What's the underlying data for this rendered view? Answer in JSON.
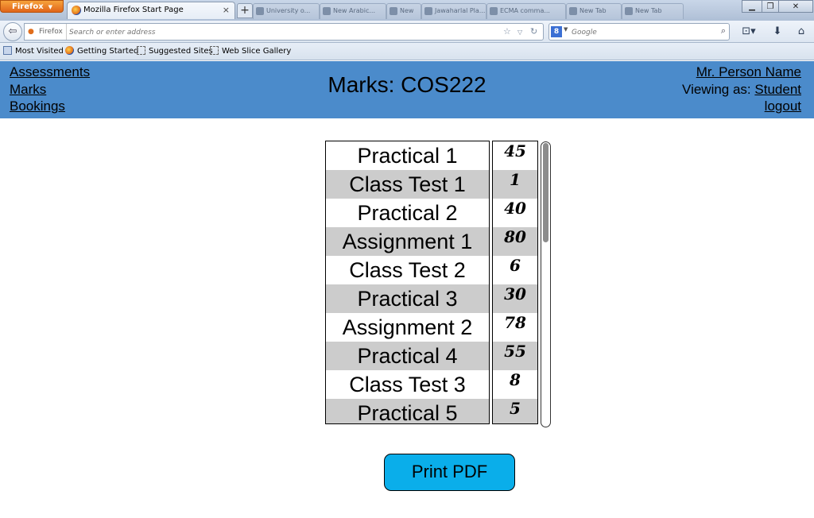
{
  "browser": {
    "menu_button": "Firefox",
    "active_tab_title": "Mozilla Firefox Start Page",
    "identity_label": "Firefox",
    "url_placeholder": "Search or enter address",
    "search_placeholder": "Google",
    "search_engine_letter": "8",
    "background_tabs": [
      "University o...",
      "New Arabic...",
      "New",
      "Jawaharlal Pla...",
      "ECMA comma...",
      "New Tab",
      "New Tab"
    ],
    "bookmarks": [
      {
        "label": "Most Visited",
        "icon": "most-visited-icon"
      },
      {
        "label": "Getting Started",
        "icon": "firefox-icon"
      },
      {
        "label": "Suggested Sites",
        "icon": "dashed-folder-icon"
      },
      {
        "label": "Web Slice Gallery",
        "icon": "dashed-folder-icon"
      }
    ]
  },
  "header": {
    "nav": [
      "Assessments",
      "Marks",
      "Bookings"
    ],
    "title": "Marks: COS222",
    "user_name": "Mr. Person Name",
    "viewing_as_label": "Viewing as: ",
    "role": "Student",
    "logout": "logout",
    "color": "#4b8bcb"
  },
  "assessments": [
    {
      "name": "Practical 1",
      "mark": "45"
    },
    {
      "name": "Class Test 1",
      "mark": "1"
    },
    {
      "name": "Practical 2",
      "mark": "40"
    },
    {
      "name": "Assignment 1",
      "mark": "80"
    },
    {
      "name": "Class Test 2",
      "mark": "6"
    },
    {
      "name": "Practical 3",
      "mark": "30"
    },
    {
      "name": "Assignment 2",
      "mark": "78"
    },
    {
      "name": "Practical 4",
      "mark": "55"
    },
    {
      "name": "Class Test 3",
      "mark": "8"
    },
    {
      "name": "Practical 5",
      "mark": "5"
    }
  ],
  "print_button": "Print PDF",
  "print_button_color": "#0aaeea",
  "row_alt_color": "#cccccc"
}
